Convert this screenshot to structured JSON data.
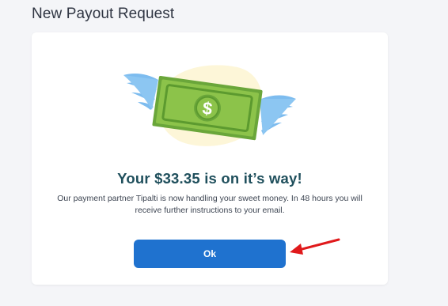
{
  "page": {
    "title": "New Payout Request"
  },
  "dialog": {
    "illustration_icon": "flying-money-icon",
    "headline": "Your $33.35 is on it’s way!",
    "message": "Our payment partner Tipalti is now handling your sweet money. In 48 hours you will receive further instructions to your email.",
    "ok_label": "Ok",
    "currency_symbol": "$"
  },
  "annotation": {
    "icon": "red-arrow-icon"
  },
  "colors": {
    "background": "#f4f5f8",
    "card": "#ffffff",
    "accent_button": "#1f72cf",
    "headline": "#1f4f5c",
    "annotation_arrow": "#e0191b",
    "money_green": "#8cc34a",
    "wing_blue": "#7dbcef",
    "blob_yellow": "#fdf6d8"
  }
}
